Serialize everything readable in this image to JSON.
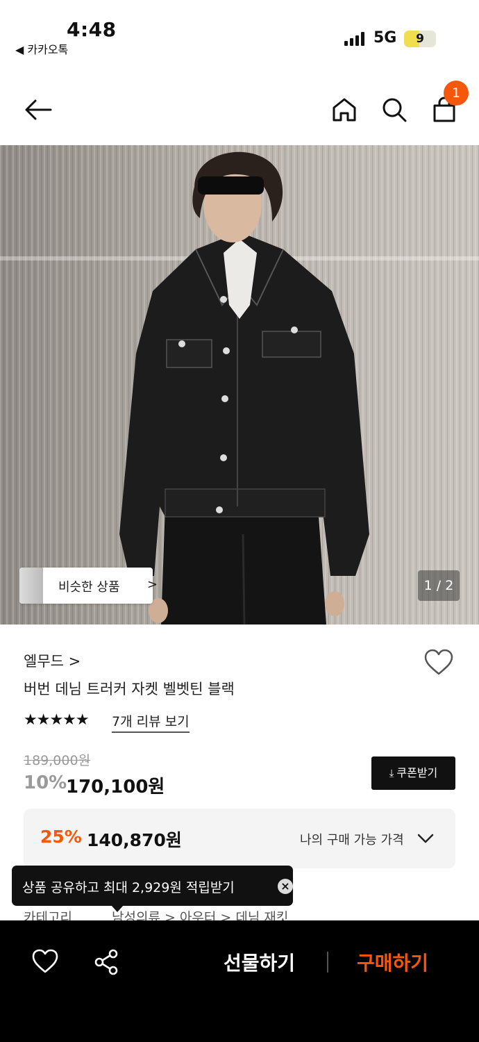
{
  "status_bar": {
    "time": "4:48",
    "back_app": "◀ 카카오톡",
    "network": "5G",
    "battery": "9"
  },
  "header": {
    "cart_count": "1"
  },
  "product_image": {
    "similar_label": "비슷한 상품",
    "similar_chevron": ">",
    "page_indicator": "1 / 2"
  },
  "product": {
    "brand": "엘무드 >",
    "title": "버번 데님 트러커 자켓 벨벳틴 블랙",
    "stars": "★★★★★",
    "review_link": "7개 리뷰 보기",
    "original_price": "189,000원",
    "discount": "10%",
    "price": "170,100원",
    "coupon_label": "쿠폰받기"
  },
  "my_price": {
    "discount": "25%",
    "price": "140,870원",
    "label": "나의 구매 가능 가격"
  },
  "tooltip": {
    "text": "상품 공유하고 최대 2,929원 적립받기",
    "close": "×"
  },
  "breadcrumb": {
    "label": "카테고리",
    "path": "남성의류 > 아우터 > 데님 재킷"
  },
  "bottom_bar": {
    "gift_label": "선물하기",
    "buy_label": "구매하기"
  },
  "colors": {
    "accent": "#f5580d",
    "bar": "#000000"
  }
}
